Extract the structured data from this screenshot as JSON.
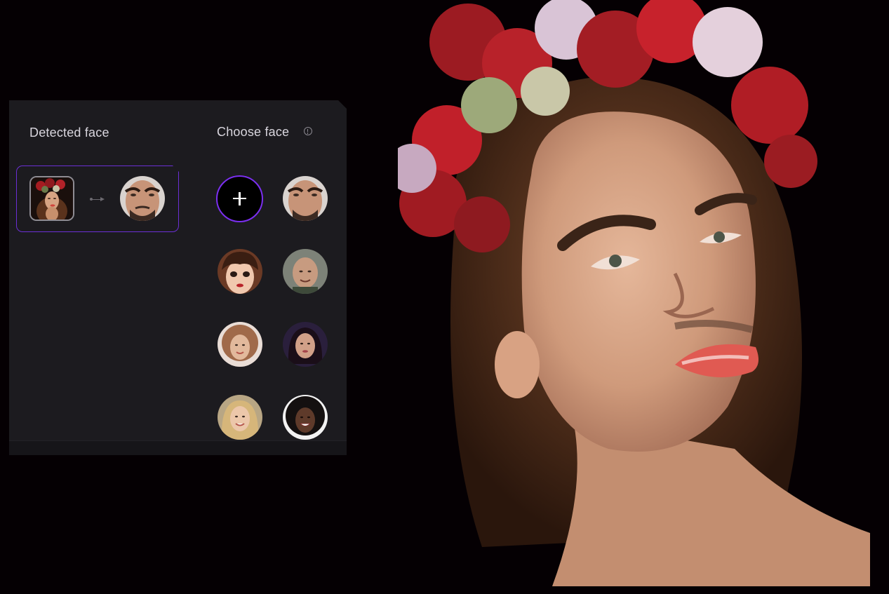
{
  "panel": {
    "detected_header": "Detected face",
    "choose_header": "Choose face",
    "info_icon": "info-circle-icon",
    "add_icon": "plus-icon",
    "accent_color": "#7b2ff0",
    "panel_color": "#1c1b1f"
  },
  "detected_pair": {
    "source": "woman with flower crown",
    "target": "man with beard"
  },
  "face_options": [
    "man with beard",
    "cartoon girl with bangs",
    "bald smiling man",
    "curly haired woman",
    "dark haired woman",
    "blonde woman",
    "smiling woman with curly hair"
  ]
}
